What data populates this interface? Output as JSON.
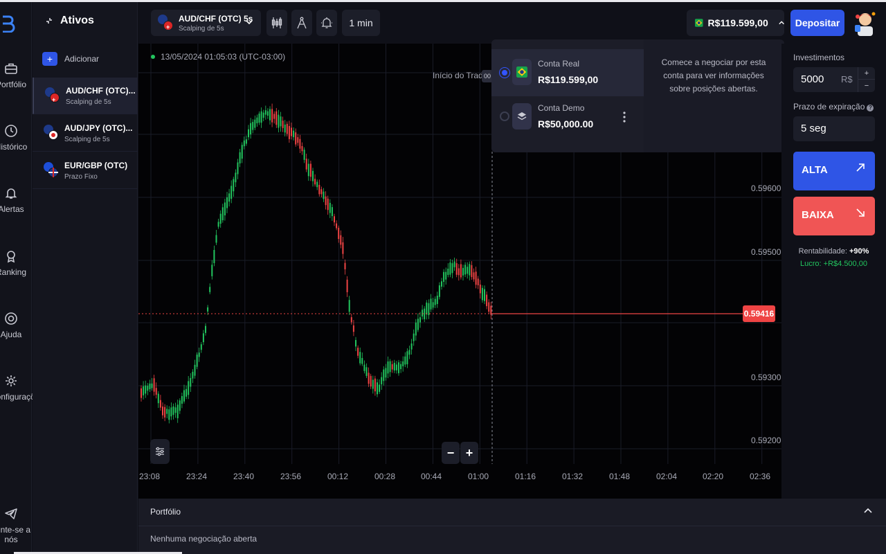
{
  "sidebar": {
    "items": [
      {
        "icon": "briefcase-icon",
        "label": "Portfólio"
      },
      {
        "icon": "history-icon",
        "label": "Histórico"
      },
      {
        "icon": "bell-icon",
        "label": "Alertas"
      },
      {
        "icon": "trophy-icon",
        "label": "Ranking"
      },
      {
        "icon": "lifebuoy-icon",
        "label": "Ajuda"
      },
      {
        "icon": "gear-icon",
        "label": "Configurações"
      },
      {
        "icon": "telegram-icon",
        "label": "Junte-se a nós"
      }
    ]
  },
  "assets": {
    "title": "Ativos",
    "add_label": "Adicionar",
    "list": [
      {
        "name": "AUD/CHF (OTC)...",
        "sub": "Scalping de 5s",
        "active": true
      },
      {
        "name": "AUD/JPY (OTC)...",
        "sub": "Scalping de 5s",
        "active": false
      },
      {
        "name": "EUR/GBP (OTC)",
        "sub": "Prazo Fixo",
        "active": false
      }
    ]
  },
  "topbar": {
    "pair_name": "AUD/CHF (OTC) 5s",
    "pair_sub": "Scalping de 5s",
    "timeframe": "1 min",
    "balance": "R$119.599,00",
    "deposit_label": "Depositar"
  },
  "chart": {
    "timestamp": "13/05/2024  01:05:03  (UTC-03:00)",
    "trade_start": "Início do Trade",
    "trade_chip": "00",
    "current_price": "0.59416",
    "y_ticks": [
      "0.59600",
      "0.59500",
      "0.59300",
      "0.59200"
    ],
    "x_ticks": [
      "23:08",
      "23:24",
      "23:40",
      "23:56",
      "00:12",
      "00:28",
      "00:44",
      "01:00",
      "01:16",
      "01:32",
      "01:48",
      "02:04",
      "02:20",
      "02:36"
    ],
    "zoom_out": "−",
    "zoom_in": "+",
    "colors": {
      "up": "#22c55e",
      "down": "#ef4444",
      "price_line": "#ef4444"
    }
  },
  "accounts_popup": {
    "accounts": [
      {
        "label": "Conta Real",
        "amount": "R$119.599,00",
        "selected": true
      },
      {
        "label": "Conta Demo",
        "amount": "R$50,000.00",
        "selected": false
      }
    ],
    "info": "Comece a negociar por esta conta para ver informações sobre posições abertas."
  },
  "trade_panel": {
    "investment_label": "Investimentos",
    "investment_value": "5000",
    "currency": "R$",
    "plus": "+",
    "minus": "−",
    "expiry_label": "Prazo de expiração",
    "expiry_help": "?",
    "expiry_value": "5 seg",
    "up_label": "ALTA",
    "down_label": "BAIXA",
    "profitability_label": "Rentabilidade:",
    "profitability_value": "+90%",
    "profit_label": "Lucro:",
    "profit_value": "+R$4.500,00",
    "colors": {
      "up": "#2f55e6",
      "down": "#f05555",
      "profit": "#22c55e"
    }
  },
  "portfolio": {
    "title": "Portfólio",
    "empty": "Nenhuma negociação aberta"
  }
}
